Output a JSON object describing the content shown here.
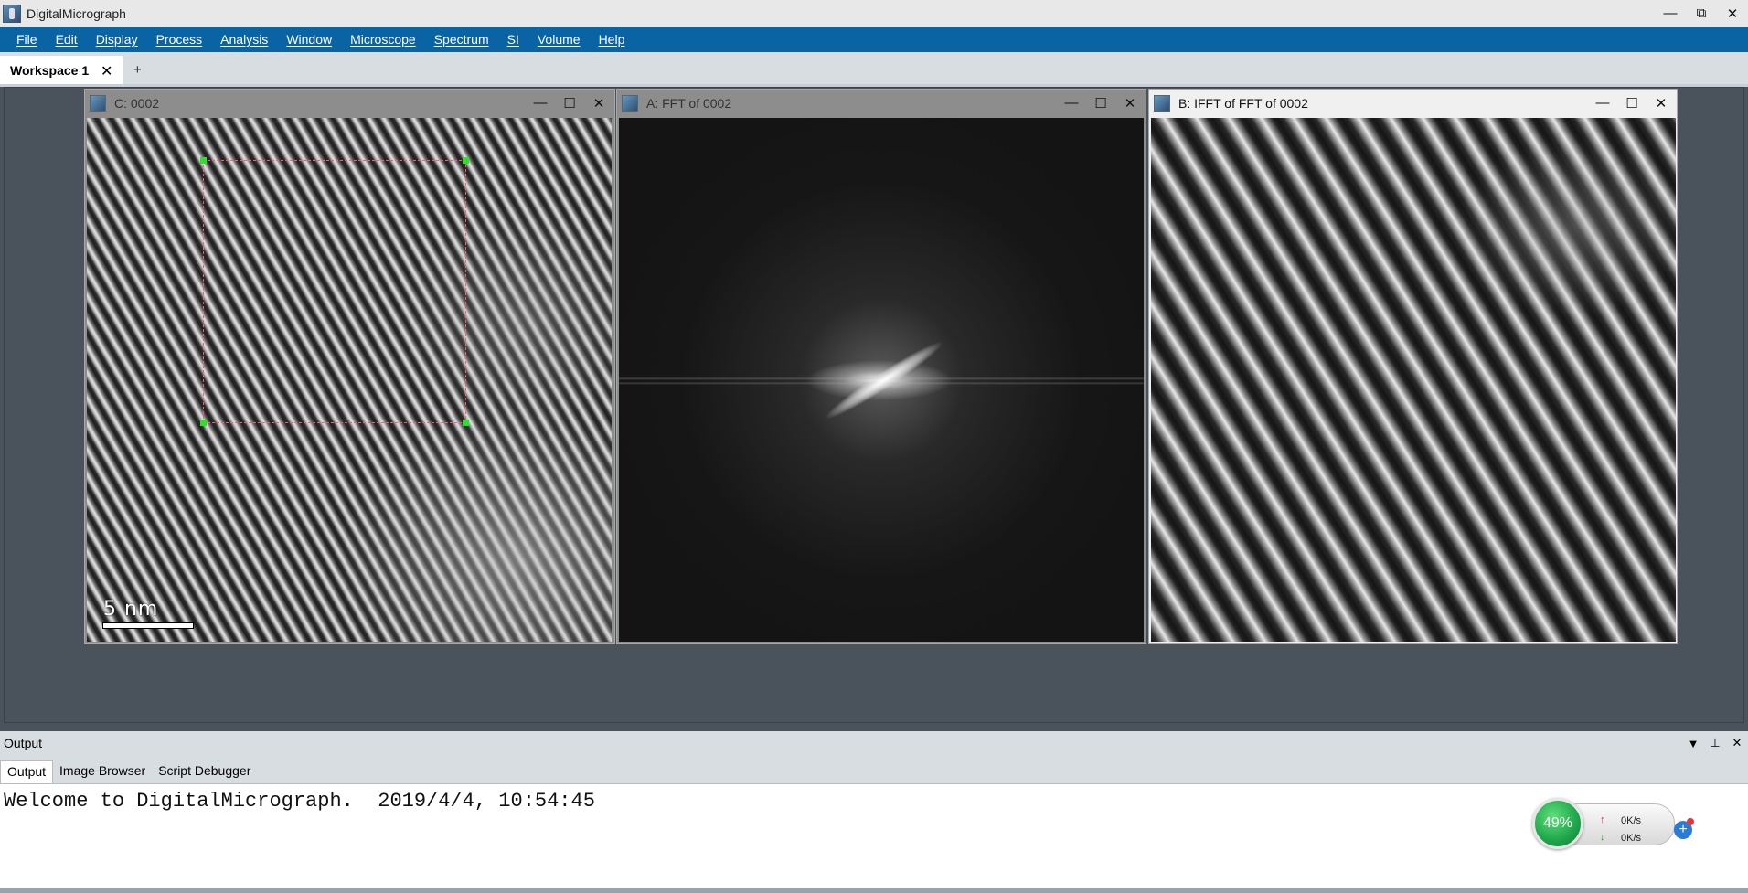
{
  "app": {
    "title": "DigitalMicrograph"
  },
  "window_controls": {
    "minimize": "—",
    "restore": "⧉",
    "close": "✕"
  },
  "menu": [
    "File",
    "Edit",
    "Display",
    "Process",
    "Analysis",
    "Window",
    "Microscope",
    "Spectrum",
    "SI",
    "Volume",
    "Help"
  ],
  "workspace_tabs": {
    "active": "Workspace 1",
    "close": "✕",
    "add": "+"
  },
  "image_windows": [
    {
      "title": "C: 0002",
      "scalebar": "5 nm"
    },
    {
      "title": "A: FFT of 0002"
    },
    {
      "title": "B: IFFT of FFT of 0002"
    }
  ],
  "image_controls": {
    "minimize": "—",
    "maximize": "☐",
    "close": "✕"
  },
  "output_panel": {
    "title": "Output",
    "tabs": [
      "Output",
      "Image Browser",
      "Script Debugger"
    ],
    "active_tab": "Output",
    "text": "Welcome to DigitalMicrograph.  2019/4/4, 10:54:45"
  },
  "output_controls": {
    "dropdown": "▼",
    "pin": "⊥",
    "close": "✕"
  },
  "net_widget": {
    "percent": "49%",
    "up_rate": "0K/s",
    "down_rate": "0K/s",
    "up_arrow": "↑",
    "down_arrow": "↓",
    "plus": "+"
  }
}
